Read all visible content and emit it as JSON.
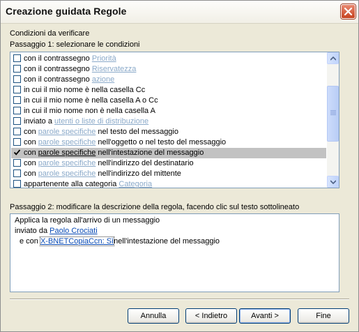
{
  "window": {
    "title": "Creazione guidata Regole"
  },
  "conditions_heading": "Condizioni da verificare",
  "step1_label": "Passaggio 1: selezionare le condizioni",
  "conditions": [
    {
      "prefix": "con il contrassegno ",
      "link": "Priorità",
      "suffix": "",
      "checked": false,
      "selected": false
    },
    {
      "prefix": "con il contrassegno ",
      "link": "Riservatezza",
      "suffix": "",
      "checked": false,
      "selected": false
    },
    {
      "prefix": "con il contrassegno ",
      "link": "azione",
      "suffix": "",
      "checked": false,
      "selected": false
    },
    {
      "prefix": "in cui il mio nome è nella casella Cc",
      "link": "",
      "suffix": "",
      "checked": false,
      "selected": false
    },
    {
      "prefix": "in cui il mio nome è nella casella A o Cc",
      "link": "",
      "suffix": "",
      "checked": false,
      "selected": false
    },
    {
      "prefix": "in cui il mio nome non è nella casella A",
      "link": "",
      "suffix": "",
      "checked": false,
      "selected": false
    },
    {
      "prefix": "inviato a ",
      "link": "utenti o liste di distribuzione",
      "suffix": "",
      "checked": false,
      "selected": false
    },
    {
      "prefix": "con ",
      "link": "parole specifiche",
      "suffix": " nel testo del messaggio",
      "checked": false,
      "selected": false
    },
    {
      "prefix": "con ",
      "link": "parole specifiche",
      "suffix": " nell'oggetto o nel testo del messaggio",
      "checked": false,
      "selected": false
    },
    {
      "prefix": "con ",
      "link": "parole specifiche",
      "suffix": " nell'intestazione del messaggio",
      "checked": true,
      "selected": true
    },
    {
      "prefix": "con ",
      "link": "parole specifiche",
      "suffix": " nell'indirizzo del destinatario",
      "checked": false,
      "selected": false
    },
    {
      "prefix": "con ",
      "link": "parole specifiche",
      "suffix": " nell'indirizzo del mittente",
      "checked": false,
      "selected": false
    },
    {
      "prefix": "appartenente alla categoria ",
      "link": "Categoria",
      "suffix": "",
      "checked": false,
      "selected": false
    }
  ],
  "step2_label": "Passaggio 2: modificare la descrizione della regola, facendo clic sul testo sottolineato",
  "description": {
    "line1": "Applica la regola all'arrivo di un messaggio",
    "line2_prefix": "inviato da ",
    "line2_link": "Paolo Crociati",
    "line3_prefix": "e con ",
    "line3_link": "X-BNETCopiaCcn: Sì",
    "line3_suffix": "nell'intestazione del messaggio"
  },
  "buttons": {
    "cancel": "Annulla",
    "back": "< Indietro",
    "next": "Avanti >",
    "finish": "Fine"
  },
  "icons": {
    "close": "close-x-icon",
    "scroll_up": "scroll-up-arrow-icon",
    "scroll_down": "scroll-down-arrow-icon",
    "check": "checkmark-icon"
  },
  "colors": {
    "title_close": "#c6421f",
    "link_disabled": "#8aa9c9",
    "link_active": "#0a4bb5",
    "selection": "#c2c2c2"
  }
}
